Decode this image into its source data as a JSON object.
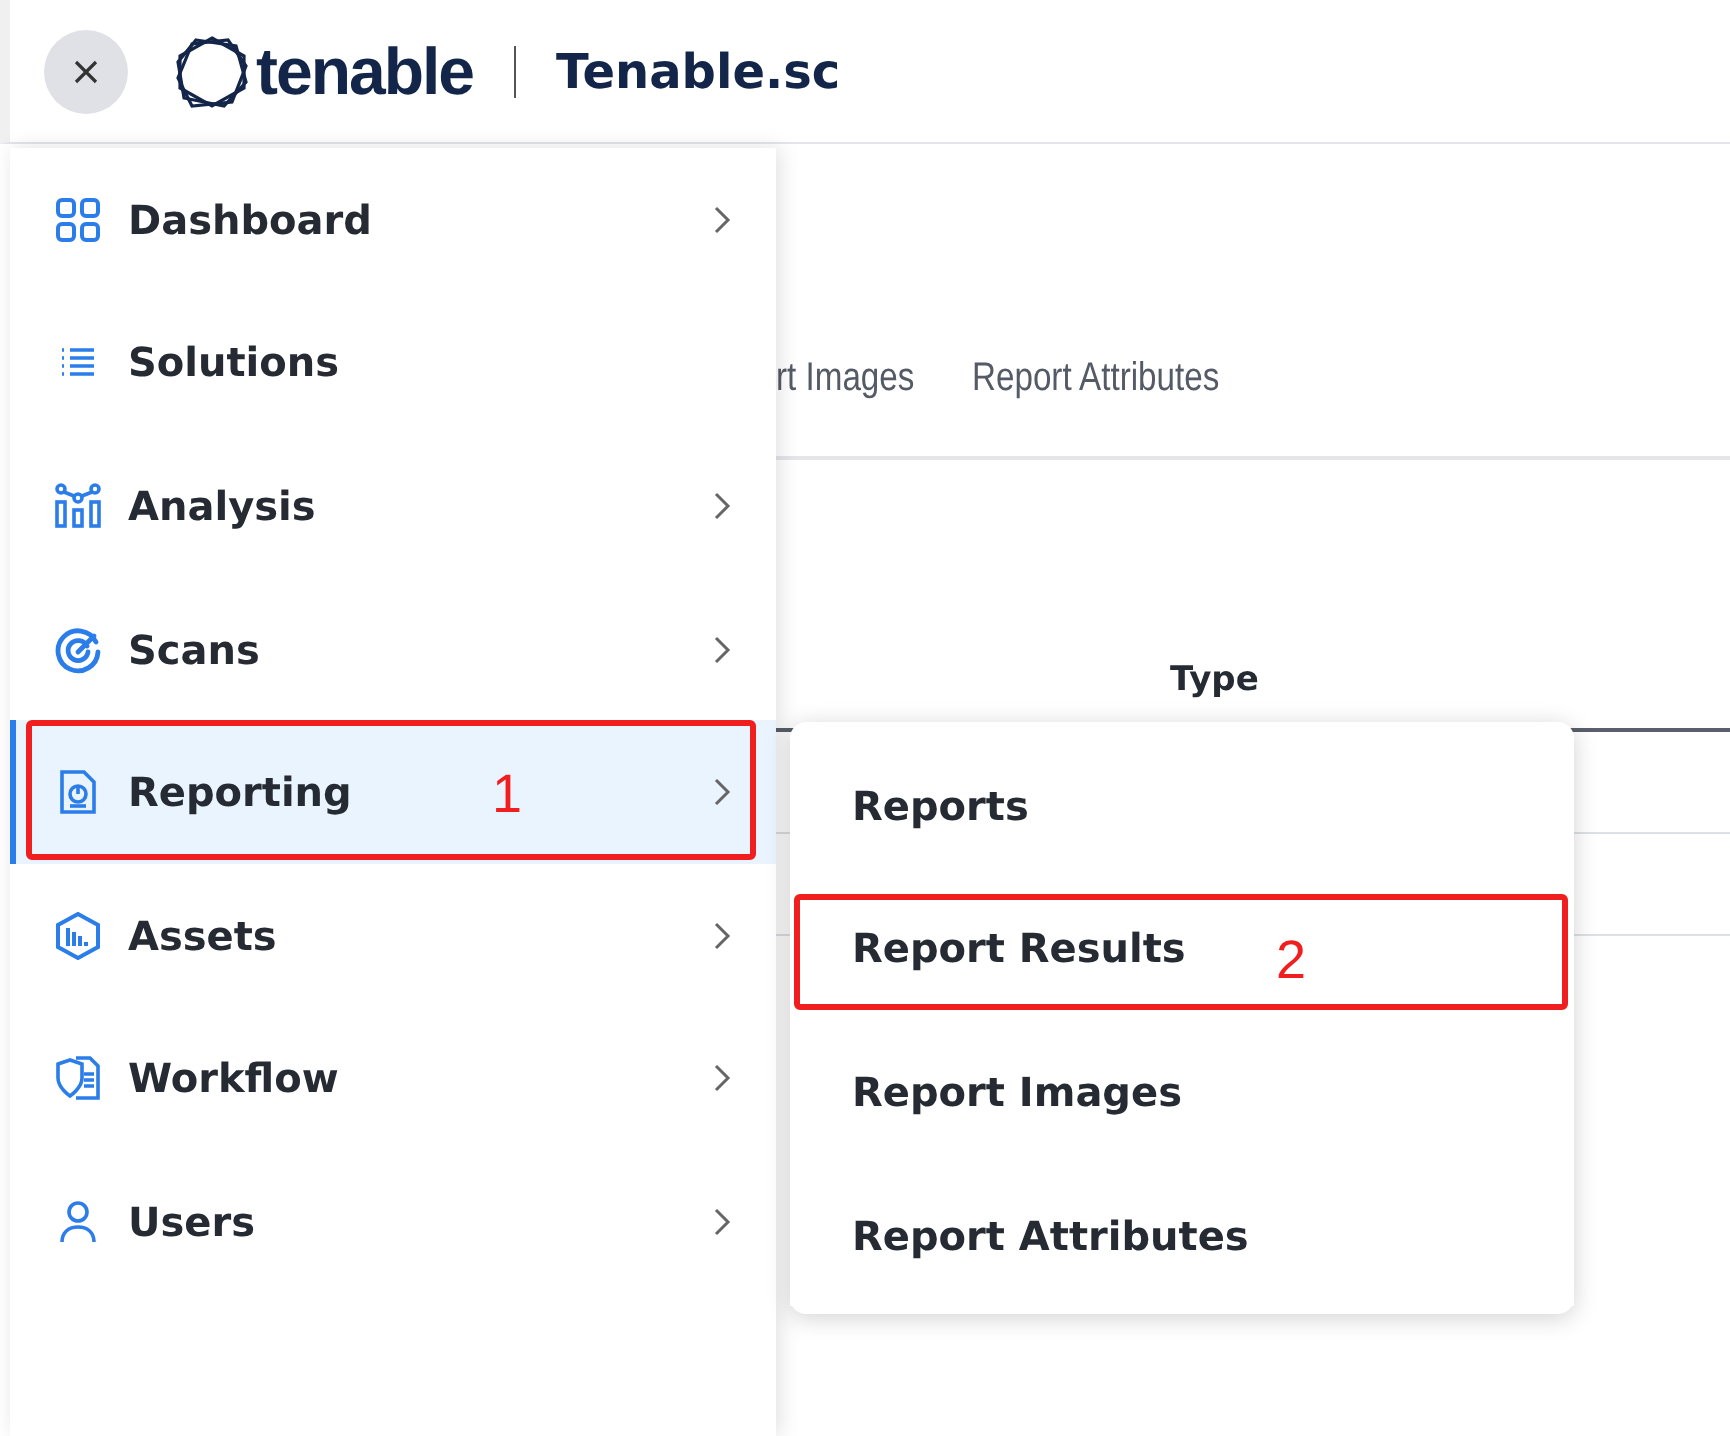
{
  "header": {
    "brand": "tenable",
    "product": "Tenable.sc"
  },
  "page": {
    "tabs": [
      {
        "label": "rt Images",
        "selected": false
      },
      {
        "label": "Report Attributes",
        "selected": false
      }
    ],
    "table": {
      "columns": [
        "Type"
      ]
    }
  },
  "sidebar": {
    "items": [
      {
        "label": "Dashboard",
        "selected": false,
        "has_submenu": true
      },
      {
        "label": "Solutions",
        "selected": false,
        "has_submenu": false
      },
      {
        "label": "Analysis",
        "selected": false,
        "has_submenu": true
      },
      {
        "label": "Scans",
        "selected": false,
        "has_submenu": true
      },
      {
        "label": "Reporting",
        "selected": true,
        "has_submenu": true
      },
      {
        "label": "Assets",
        "selected": false,
        "has_submenu": true
      },
      {
        "label": "Workflow",
        "selected": false,
        "has_submenu": true
      },
      {
        "label": "Users",
        "selected": false,
        "has_submenu": true
      }
    ]
  },
  "submenu": {
    "items": [
      {
        "label": "Reports",
        "selected": false
      },
      {
        "label": "Report Results",
        "selected": false
      },
      {
        "label": "Report Images",
        "selected": false
      },
      {
        "label": "Report Attributes",
        "selected": false
      }
    ]
  },
  "annotations": [
    {
      "label": "1"
    },
    {
      "label": "2"
    }
  ]
}
